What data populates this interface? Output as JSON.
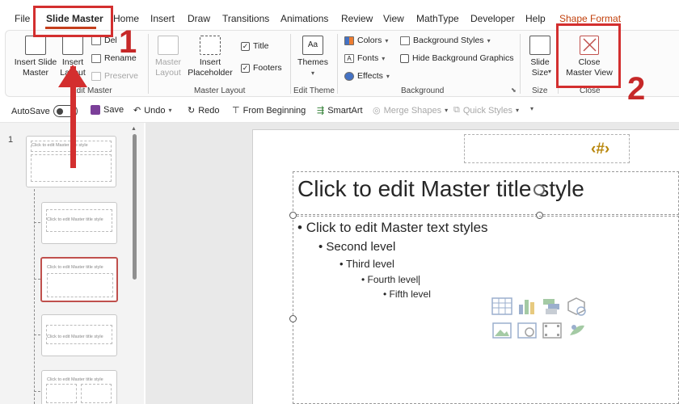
{
  "menu": {
    "tabs": [
      "File",
      "Slide Master",
      "Home",
      "Insert",
      "Draw",
      "Transitions",
      "Animations",
      "Review",
      "View",
      "MathType",
      "Developer",
      "Help",
      "Shape Format"
    ],
    "active_tab": "Slide Master"
  },
  "ribbon": {
    "edit_master": {
      "label": "Edit Master",
      "insert_slide_master": "Insert Slide\nMaster",
      "insert_layout": "Insert\nLayout",
      "delete": "Del",
      "rename": "Rename",
      "preserve": "Preserve"
    },
    "master_layout": {
      "label": "Master Layout",
      "master_layout_btn": "Master\nLayout",
      "insert_placeholder": "Insert\nPlaceholder",
      "title": "Title",
      "footers": "Footers"
    },
    "edit_theme": {
      "label": "Edit Theme",
      "themes": "Themes"
    },
    "background": {
      "label": "Background",
      "colors": "Colors",
      "fonts": "Fonts",
      "effects": "Effects",
      "background_styles": "Background Styles",
      "hide_background_graphics": "Hide Background Graphics"
    },
    "size": {
      "label": "Size",
      "slide_size": "Slide\nSize"
    },
    "close": {
      "label": "Close",
      "close_master_view": "Close\nMaster View"
    }
  },
  "qat": {
    "autosave": "AutoSave",
    "autosave_state": "Off",
    "save": "Save",
    "undo": "Undo",
    "redo": "Redo",
    "from_beginning": "From Beginning",
    "smartart": "SmartArt",
    "merge_shapes": "Merge Shapes",
    "quick_styles": "Quick Styles"
  },
  "thumbnails": {
    "slide_number": "1",
    "master_title": "Click to edit Master title style",
    "layout_title": "Click to edit Master title style"
  },
  "slide": {
    "number_placeholder": "‹#›",
    "title": "Click to edit Master title style",
    "levels": [
      "Click to edit Master text styles",
      "Second level",
      "Third level",
      "Fourth level",
      "Fifth level"
    ]
  },
  "annotations": {
    "step1": "1",
    "step2": "2"
  },
  "colors": {
    "accent": "#c43e1c",
    "annotation_red": "#d32f2f",
    "slide_number_gold": "#b8860b"
  }
}
